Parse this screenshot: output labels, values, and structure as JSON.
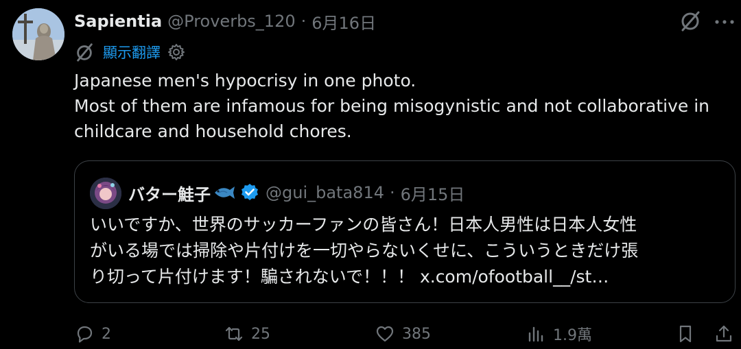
{
  "post": {
    "author_name": "Sapientia",
    "author_handle": "@Proverbs_120",
    "separator": "·",
    "date": "6月16日",
    "translate_label": "顯示翻譯",
    "text_lines": [
      "Japanese men's hypocrisy in one photo.",
      "Most of them are infamous for being misogynistic and not collaborative in",
      "childcare and household chores."
    ]
  },
  "quote": {
    "author_name": "バター鮭子",
    "author_handle": "@gui_bata814",
    "separator": "·",
    "date": "6月15日",
    "text_lines": [
      "いいですか、世界のサッカーファンの皆さん！日本人男性は日本人女性",
      "がいる場では掃除や片付けを一切やらないくせに、こういうときだけ張",
      "り切って片付けます！騙されないで！！！ x.com/ofootball__/st…"
    ]
  },
  "actions": {
    "reply_count": "2",
    "repost_count": "25",
    "like_count": "385",
    "views_count": "1.9萬"
  },
  "icons": {
    "top_right": [
      "grok-icon",
      "more-icon"
    ],
    "translate": [
      "grok-icon",
      "gear-icon"
    ],
    "quote_badges": [
      "fish-emoji-icon",
      "verified-badge-icon"
    ],
    "actions": [
      "reply-icon",
      "repost-icon",
      "like-icon",
      "views-icon",
      "bookmark-icon",
      "share-icon"
    ]
  },
  "colors": {
    "background": "#000000",
    "text": "#e7e9ea",
    "muted": "#71767b",
    "accent": "#1d9bf0",
    "border": "#3d4247"
  }
}
